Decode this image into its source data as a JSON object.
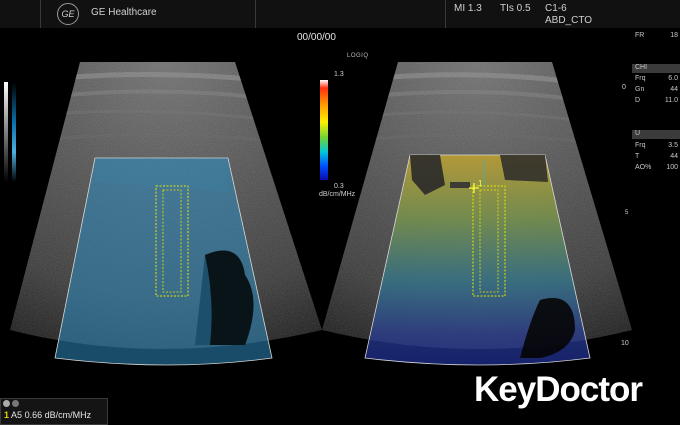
{
  "header": {
    "brand": "GE Healthcare",
    "logo_text": "GE",
    "mi": "MI 1.3",
    "tis": "TIs 0.5",
    "probe": "C1-6",
    "preset": "ABD_CTO"
  },
  "date": "00/00/00",
  "system_label": "LOGIQ",
  "scale": {
    "max": "1.3",
    "min": "0.3",
    "unit": "dB/cm/MHz"
  },
  "right_panel": {
    "fr_label": "FR",
    "fr_value": "18",
    "chi_header": "CHI",
    "frq_label": "Frq",
    "frq_value": "6.0",
    "gn_label": "Gn",
    "gn_value": "44",
    "d_label": "D",
    "d_value": "11.0",
    "u_header": "U",
    "frq2_label": "Frq",
    "frq2_value": "3.5",
    "t_label": "T",
    "t_value": "44",
    "ao_label": "AO%",
    "ao_value": "100"
  },
  "ruler": {
    "top": "0",
    "mid": "5",
    "bottom": "10"
  },
  "roi_marker": "1",
  "measurement": {
    "index": "1",
    "label": "A5",
    "value": "0.66 dB/cm/MHz"
  },
  "watermark": "KeyDoctor",
  "colors": {
    "roi_outline": "#e6e600",
    "left_overlay": "#2e8fc0",
    "background": "#000000"
  }
}
